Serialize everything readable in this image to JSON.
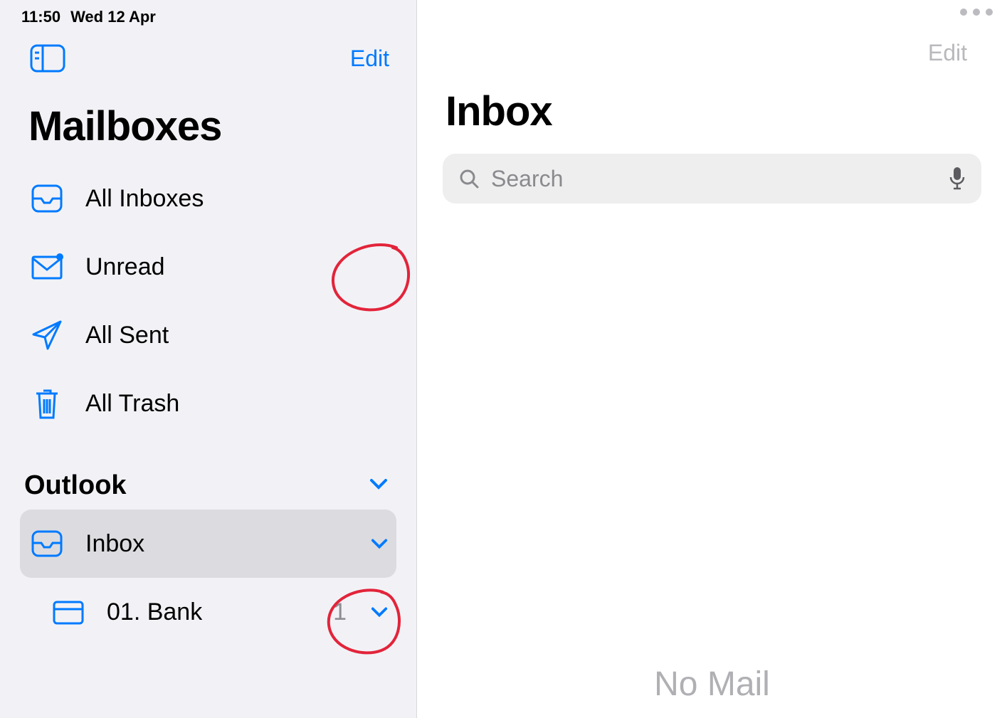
{
  "statusbar": {
    "time": "11:50",
    "date": "Wed 12 Apr"
  },
  "sidebar": {
    "edit": "Edit",
    "title": "Mailboxes",
    "smart": {
      "all_inboxes": "All Inboxes",
      "unread": "Unread",
      "all_sent": "All Sent",
      "all_trash": "All Trash"
    },
    "account": {
      "name": "Outlook",
      "inbox": "Inbox",
      "folders": [
        {
          "name": "01. Bank",
          "count": "1"
        }
      ]
    }
  },
  "main": {
    "edit": "Edit",
    "title": "Inbox",
    "search_placeholder": "Search",
    "empty": "No Mail"
  },
  "colors": {
    "accent": "#007aff"
  }
}
